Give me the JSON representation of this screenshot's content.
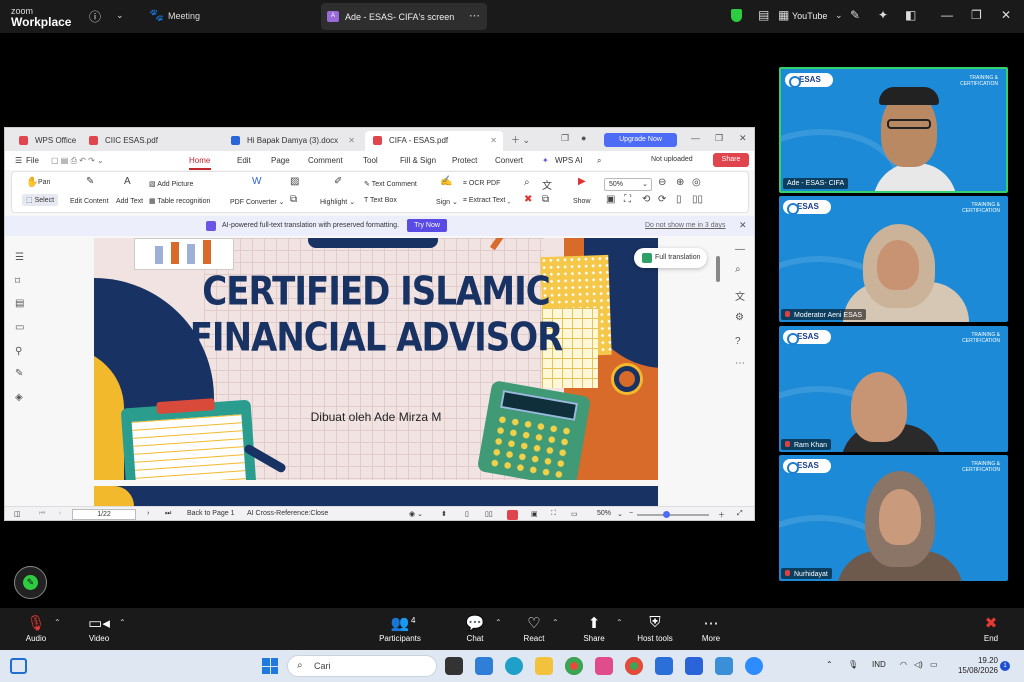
{
  "zoom_top": {
    "logo_line1": "zoom",
    "logo_line2": "Workplace",
    "meeting_label": "Meeting",
    "share_tab_avatar": "A",
    "share_tab_title": "Ade - ESAS- CIFA's screen",
    "youtube_label": "YouTube"
  },
  "wps": {
    "tabs": [
      {
        "label": "WPS Office",
        "color": "#e0444d"
      },
      {
        "label": "CIIC ESAS.pdf",
        "color": "#e0444d"
      },
      {
        "label": "Hi Bapak Damya (3).docx",
        "color": "#2b63d8"
      },
      {
        "label": "CIFA - ESAS.pdf",
        "color": "#e0444d"
      }
    ],
    "upgrade_label": "Upgrade Now",
    "menu": {
      "file": "File",
      "items": [
        "Home",
        "Edit",
        "Page",
        "Comment",
        "Tool",
        "Fill & Sign",
        "Protect",
        "Convert",
        "WPS AI"
      ],
      "not_uploaded": "Not uploaded",
      "share": "Share"
    },
    "ribbon": {
      "pan": "Pan",
      "select": "Select",
      "edit_content": "Edit Content",
      "add_text": "Add Text",
      "add_picture": "Add Picture",
      "table_recognition": "Table recognition",
      "pdf_converter": "PDF Converter",
      "highlight": "Highlight",
      "text_comment": "Text Comment",
      "text_box": "Text Box",
      "sign": "Sign",
      "ocr_pdf": "OCR PDF",
      "extract_text": "Extract Text",
      "show": "Show",
      "zoom_value": "50%"
    },
    "ai_bar": {
      "text": "AI-powered full-text translation with preserved formatting.",
      "try_now": "Try Now",
      "dont_show": "Do not show me in 3 days"
    },
    "full_translation": "Full translation",
    "slide": {
      "title_line1": "CERTIFIED ISLAMIC",
      "title_line2": "FINANCIAL ADVISOR",
      "byline": "Dibuat oleh Ade Mirza M"
    },
    "status": {
      "page": "1/22",
      "back_to_page": "Back to Page 1",
      "ai_cross": "AI Cross-Reference:Close",
      "zoom": "50%"
    }
  },
  "participants_video": [
    {
      "name": "Ade - ESAS- CIFA",
      "active": true,
      "mic_muted": false
    },
    {
      "name": "Moderator Aeni ESAS",
      "active": false,
      "mic_muted": true
    },
    {
      "name": "Ram Khan",
      "active": false,
      "mic_muted": true
    },
    {
      "name": "Nurhidayat",
      "active": false,
      "mic_muted": true
    }
  ],
  "video_overlay": {
    "brand": "ESAS",
    "tc_line1": "TRAINING &",
    "tc_line2": "CERTIFICATION"
  },
  "toolbar": {
    "audio": "Audio",
    "video": "Video",
    "participants": "Participants",
    "participants_count": "4",
    "chat": "Chat",
    "react": "React",
    "share": "Share",
    "host_tools": "Host tools",
    "more": "More",
    "end": "End"
  },
  "taskbar": {
    "search_placeholder": "Cari",
    "language": "IND",
    "time": "19.20",
    "date": "15/08/2026",
    "notification_count": "1"
  }
}
